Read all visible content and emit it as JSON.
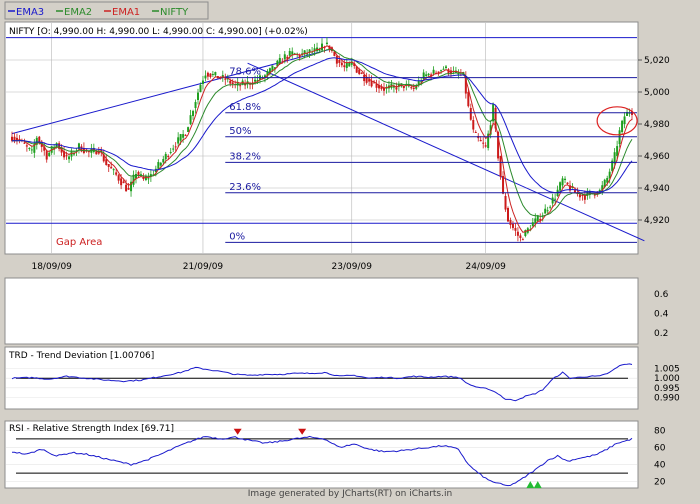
{
  "colors": {
    "ema3": "#1a1acc",
    "ema2": "#2c8a2c",
    "ema1": "#cc2222",
    "nifty": "#2a8a2a",
    "up": "#1e9e1e",
    "down": "#cc1a1a",
    "fib": "#1a1aa0",
    "line": "#1a1acc",
    "grid": "#b8b8b8",
    "frame": "#8c8c8c",
    "gap": "#cc2020",
    "annotation": "#dd2222"
  },
  "legend": [
    {
      "label": "EMA3",
      "color": "#1a1acc"
    },
    {
      "label": "EMA2",
      "color": "#2c8a2c"
    },
    {
      "label": "EMA1",
      "color": "#cc2222"
    },
    {
      "label": "NIFTY",
      "color": "#2a8a2a"
    }
  ],
  "main": {
    "header": "NIFTY [O: 4,990.00  H: 4,990.00  L: 4,990.00  C: 4,990.00] (+0.02%)",
    "gap_label": "Gap Area",
    "circle_annotation": {
      "x_index": 244,
      "price": 4982
    }
  },
  "chart_data": [
    {
      "type": "candlestick",
      "title": "NIFTY",
      "ylim": [
        4900,
        5035
      ],
      "yticks": [
        4920,
        4940,
        4960,
        4980,
        5000,
        5020
      ],
      "ytick_labels": [
        "4,920",
        "4,940",
        "4,960",
        "4,980",
        "5,000",
        "5,020"
      ],
      "dates": [
        {
          "label": "18/09/09",
          "index": 16
        },
        {
          "label": "21/09/09",
          "index": 77
        },
        {
          "label": "23/09/09",
          "index": 137
        },
        {
          "label": "24/09/09",
          "index": 191
        }
      ],
      "keypoints": [
        [
          0,
          4972
        ],
        [
          3,
          4970
        ],
        [
          6,
          4965
        ],
        [
          8,
          4962
        ],
        [
          10,
          4972
        ],
        [
          14,
          4960
        ],
        [
          18,
          4968
        ],
        [
          22,
          4958
        ],
        [
          27,
          4966
        ],
        [
          31,
          4962
        ],
        [
          35,
          4964
        ],
        [
          38,
          4955
        ],
        [
          42,
          4948
        ],
        [
          45,
          4942
        ],
        [
          47,
          4938
        ],
        [
          50,
          4950
        ],
        [
          53,
          4945
        ],
        [
          56,
          4948
        ],
        [
          60,
          4956
        ],
        [
          65,
          4966
        ],
        [
          70,
          4975
        ],
        [
          73,
          4990
        ],
        [
          76,
          5005
        ],
        [
          78,
          5012
        ],
        [
          82,
          5010
        ],
        [
          86,
          5008
        ],
        [
          90,
          5004
        ],
        [
          94,
          5005
        ],
        [
          98,
          5007
        ],
        [
          102,
          5010
        ],
        [
          106,
          5016
        ],
        [
          110,
          5022
        ],
        [
          113,
          5024
        ],
        [
          116,
          5023
        ],
        [
          120,
          5025
        ],
        [
          124,
          5026
        ],
        [
          126,
          5030
        ],
        [
          128,
          5028
        ],
        [
          131,
          5020
        ],
        [
          134,
          5015
        ],
        [
          137,
          5018
        ],
        [
          140,
          5012
        ],
        [
          143,
          5008
        ],
        [
          146,
          5005
        ],
        [
          150,
          5002
        ],
        [
          154,
          5003
        ],
        [
          158,
          5004
        ],
        [
          162,
          5002
        ],
        [
          166,
          5010
        ],
        [
          170,
          5012
        ],
        [
          174,
          5015
        ],
        [
          178,
          5012
        ],
        [
          182,
          5010
        ],
        [
          184,
          4990
        ],
        [
          186,
          4975
        ],
        [
          188,
          4970
        ],
        [
          191,
          4965
        ],
        [
          194,
          4990
        ],
        [
          196,
          4960
        ],
        [
          198,
          4935
        ],
        [
          200,
          4920
        ],
        [
          202,
          4915
        ],
        [
          205,
          4908
        ],
        [
          207,
          4912
        ],
        [
          210,
          4918
        ],
        [
          213,
          4922
        ],
        [
          216,
          4928
        ],
        [
          219,
          4935
        ],
        [
          222,
          4945
        ],
        [
          225,
          4940
        ],
        [
          228,
          4936
        ],
        [
          231,
          4935
        ],
        [
          234,
          4937
        ],
        [
          237,
          4938
        ],
        [
          240,
          4946
        ],
        [
          243,
          4960
        ],
        [
          245,
          4975
        ],
        [
          247,
          4985
        ],
        [
          249,
          4988
        ]
      ],
      "fibonacci": [
        {
          "label": "0%",
          "price": 4906
        },
        {
          "label": "23.6%",
          "price": 4937
        },
        {
          "label": "38.2%",
          "price": 4956
        },
        {
          "label": "50%",
          "price": 4972
        },
        {
          "label": "61.8%",
          "price": 4987
        },
        {
          "label": "78.6%",
          "price": 5009
        }
      ],
      "hlines": [
        5034,
        4918
      ],
      "trendlines": [
        [
          0,
          4974,
          129,
          5027
        ],
        [
          95,
          5018,
          255,
          4907
        ]
      ]
    },
    {
      "type": "line",
      "title": "",
      "ylim": [
        0.1,
        0.75
      ],
      "yticks": [
        0.2,
        0.4,
        0.6
      ],
      "ytick_labels": [
        "0.2",
        "0.4",
        "0.6"
      ]
    },
    {
      "type": "line",
      "title": "TRD - Trend Deviation [1.00706]",
      "ylim": [
        0.9855,
        1.0095
      ],
      "yticks": [
        0.99,
        0.995,
        1.0,
        1.005
      ],
      "ytick_labels": [
        "0.990",
        "0.995",
        "1.000",
        "1.005"
      ],
      "reference": 1.0,
      "keypoints": [
        [
          0,
          1.0
        ],
        [
          8,
          1.0003
        ],
        [
          15,
          0.9995
        ],
        [
          22,
          1.001
        ],
        [
          30,
          1.0
        ],
        [
          38,
          0.999
        ],
        [
          45,
          0.9985
        ],
        [
          52,
          0.999
        ],
        [
          60,
          1.001
        ],
        [
          68,
          1.003
        ],
        [
          74,
          1.0055
        ],
        [
          79,
          1.0045
        ],
        [
          84,
          1.0035
        ],
        [
          90,
          1.002
        ],
        [
          96,
          1.0015
        ],
        [
          102,
          1.002
        ],
        [
          108,
          1.002
        ],
        [
          114,
          1.0025
        ],
        [
          120,
          1.0025
        ],
        [
          126,
          1.003
        ],
        [
          132,
          1.001
        ],
        [
          138,
          1.0015
        ],
        [
          144,
          1.0
        ],
        [
          150,
          1.0005
        ],
        [
          156,
          1.0
        ],
        [
          162,
          1.001
        ],
        [
          168,
          1.0005
        ],
        [
          174,
          1.001
        ],
        [
          180,
          1.0005
        ],
        [
          184,
          0.997
        ],
        [
          188,
          0.995
        ],
        [
          192,
          0.9945
        ],
        [
          196,
          0.992
        ],
        [
          199,
          0.989
        ],
        [
          203,
          0.9885
        ],
        [
          207,
          0.9905
        ],
        [
          211,
          0.992
        ],
        [
          214,
          0.994
        ],
        [
          218,
          0.9995
        ],
        [
          222,
          1.003
        ],
        [
          225,
          1.0
        ],
        [
          229,
          1.0005
        ],
        [
          233,
          1.001
        ],
        [
          237,
          1.001
        ],
        [
          241,
          1.003
        ],
        [
          245,
          1.0065
        ],
        [
          248,
          1.0075
        ],
        [
          250,
          1.007
        ]
      ]
    },
    {
      "type": "line",
      "title": "RSI - Relative Strength Index [69.71]",
      "ylim": [
        15,
        85
      ],
      "yticks": [
        20,
        40,
        60,
        80
      ],
      "ytick_labels": [
        "20",
        "40",
        "60",
        "80"
      ],
      "reference_lines": [
        70,
        30
      ],
      "sell_markers": [
        91,
        117
      ],
      "buy_markers": [
        209,
        212
      ],
      "keypoints": [
        [
          0,
          55
        ],
        [
          6,
          52
        ],
        [
          12,
          58
        ],
        [
          18,
          50
        ],
        [
          24,
          54
        ],
        [
          30,
          52
        ],
        [
          36,
          48
        ],
        [
          42,
          44
        ],
        [
          48,
          40
        ],
        [
          54,
          45
        ],
        [
          60,
          52
        ],
        [
          66,
          60
        ],
        [
          72,
          67
        ],
        [
          78,
          73
        ],
        [
          84,
          70
        ],
        [
          90,
          72
        ],
        [
          96,
          68
        ],
        [
          102,
          65
        ],
        [
          108,
          67
        ],
        [
          114,
          70
        ],
        [
          120,
          72
        ],
        [
          126,
          70
        ],
        [
          132,
          60
        ],
        [
          138,
          64
        ],
        [
          144,
          58
        ],
        [
          150,
          55
        ],
        [
          156,
          56
        ],
        [
          162,
          58
        ],
        [
          168,
          60
        ],
        [
          174,
          62
        ],
        [
          180,
          58
        ],
        [
          184,
          40
        ],
        [
          188,
          30
        ],
        [
          192,
          22
        ],
        [
          196,
          18
        ],
        [
          200,
          15
        ],
        [
          204,
          20
        ],
        [
          208,
          28
        ],
        [
          212,
          36
        ],
        [
          216,
          45
        ],
        [
          220,
          50
        ],
        [
          224,
          44
        ],
        [
          228,
          47
        ],
        [
          232,
          49
        ],
        [
          236,
          52
        ],
        [
          240,
          58
        ],
        [
          244,
          65
        ],
        [
          248,
          68
        ],
        [
          250,
          70
        ]
      ]
    }
  ],
  "footer": "Image generated by JCharts(RT) on iCharts.in"
}
